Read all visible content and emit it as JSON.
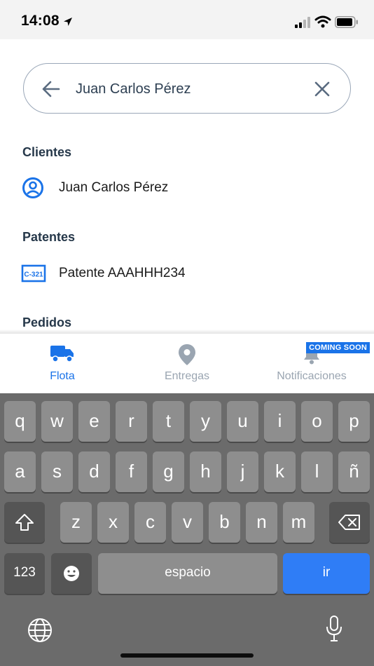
{
  "status_bar": {
    "time": "14:08"
  },
  "search": {
    "value": "Juan Carlos Pérez",
    "placeholder": ""
  },
  "sections": {
    "clients": {
      "title": "Clientes",
      "items": [
        {
          "label": "Juan Carlos Pérez",
          "icon": "user-circle-icon"
        }
      ]
    },
    "plates": {
      "title": "Patentes",
      "items": [
        {
          "label": "Patente AAAHHH234",
          "icon": "license-plate-icon",
          "badge_text": "C-321"
        }
      ]
    },
    "orders": {
      "title": "Pedidos",
      "items": []
    }
  },
  "tabbar": {
    "tabs": [
      {
        "label": "Flota",
        "icon": "truck-icon",
        "active": true
      },
      {
        "label": "Entregas",
        "icon": "location-pin-icon",
        "active": false
      },
      {
        "label": "Notificaciones",
        "icon": "bell-icon",
        "active": false,
        "badge": "COMING SOON"
      }
    ]
  },
  "keyboard": {
    "row1": [
      "q",
      "w",
      "e",
      "r",
      "t",
      "y",
      "u",
      "i",
      "o",
      "p"
    ],
    "row2": [
      "a",
      "s",
      "d",
      "f",
      "g",
      "h",
      "j",
      "k",
      "l",
      "ñ"
    ],
    "row3": [
      "z",
      "x",
      "c",
      "v",
      "b",
      "n",
      "m"
    ],
    "numbers_key": "123",
    "space_key": "espacio",
    "return_key": "ir",
    "icons": {
      "shift": "shift-icon",
      "backspace": "backspace-icon",
      "emoji": "emoji-icon",
      "globe": "globe-icon",
      "mic": "microphone-icon"
    }
  },
  "colors": {
    "accent": "#1a73e8",
    "inactive_tab": "#9aa5b1",
    "keyboard_bg": "#6b6b6b",
    "key_bg": "#8e8e8e",
    "key_dark": "#555555",
    "go_key": "#2f7df6"
  }
}
